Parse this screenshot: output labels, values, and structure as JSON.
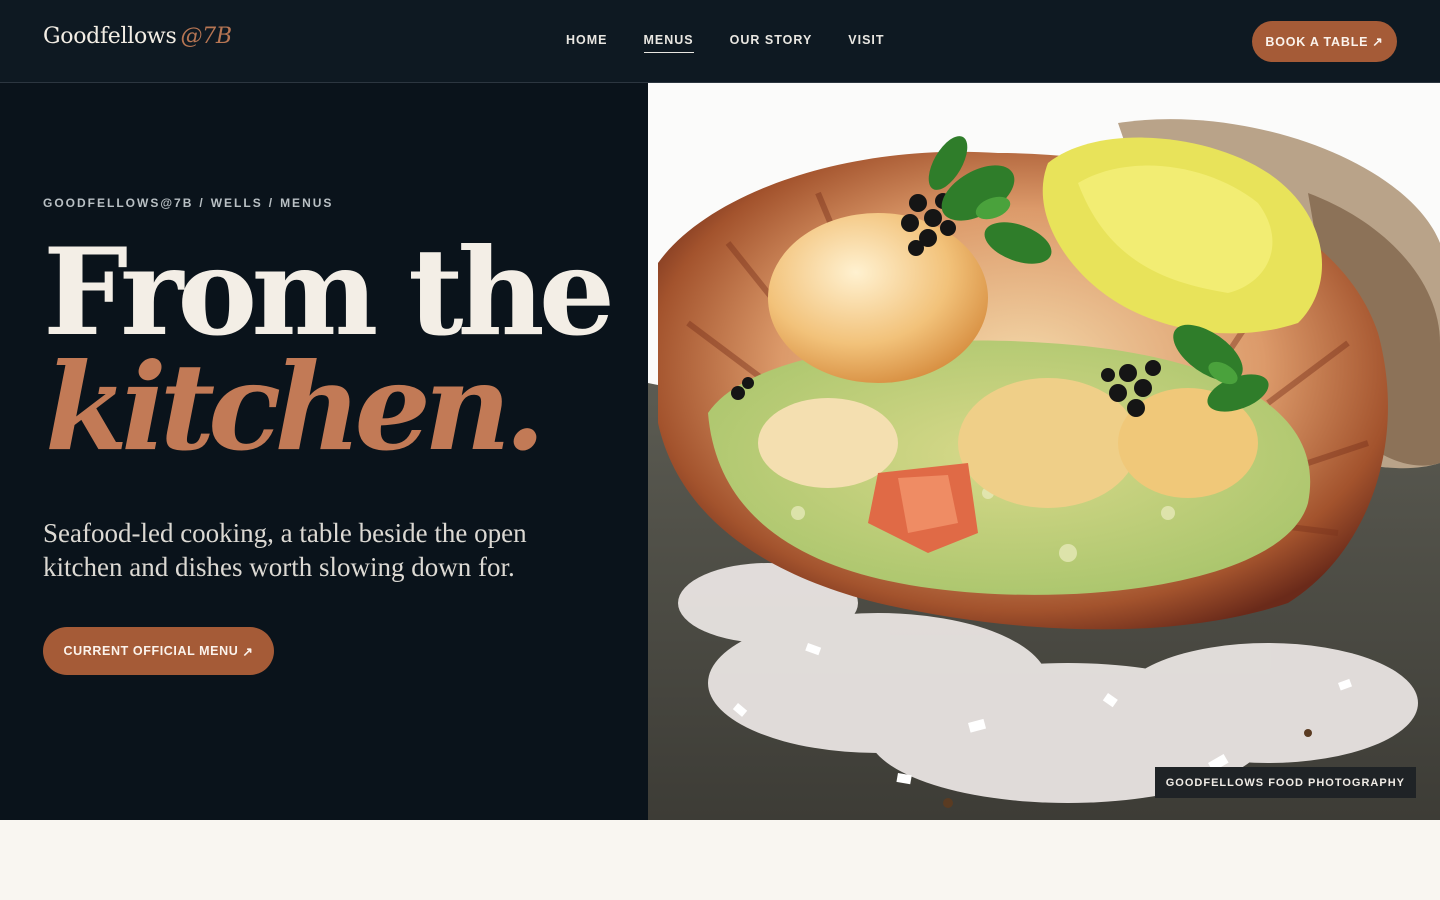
{
  "brand": {
    "name": "Goodfellows",
    "suffix": "@7B"
  },
  "nav": {
    "items": [
      {
        "label": "HOME",
        "active": false
      },
      {
        "label": "MENUS",
        "active": true
      },
      {
        "label": "OUR STORY",
        "active": false
      },
      {
        "label": "VISIT",
        "active": false
      }
    ]
  },
  "header": {
    "cta_label": "BOOK A TABLE",
    "cta_icon": "↗"
  },
  "hero": {
    "breadcrumb": [
      "GOODFELLOWS@7B",
      "WELLS",
      "MENUS"
    ],
    "breadcrumb_sep": "/",
    "headline_line1": "From the",
    "headline_line2": "kitchen.",
    "lede": "Seafood-led cooking, a table beside the open kitchen and dishes worth slowing down for.",
    "cta_label": "CURRENT OFFICIAL MENU",
    "cta_icon": "↗",
    "image_credit": "GOODFELLOWS FOOD PHOTOGRAPHY"
  },
  "colors": {
    "background": "#0a131b",
    "header": "#0e1922",
    "accent": "#a55b37",
    "headline_accent": "#c27a56",
    "text": "#f3eee6",
    "bottom_section": "#f9f6f1"
  }
}
